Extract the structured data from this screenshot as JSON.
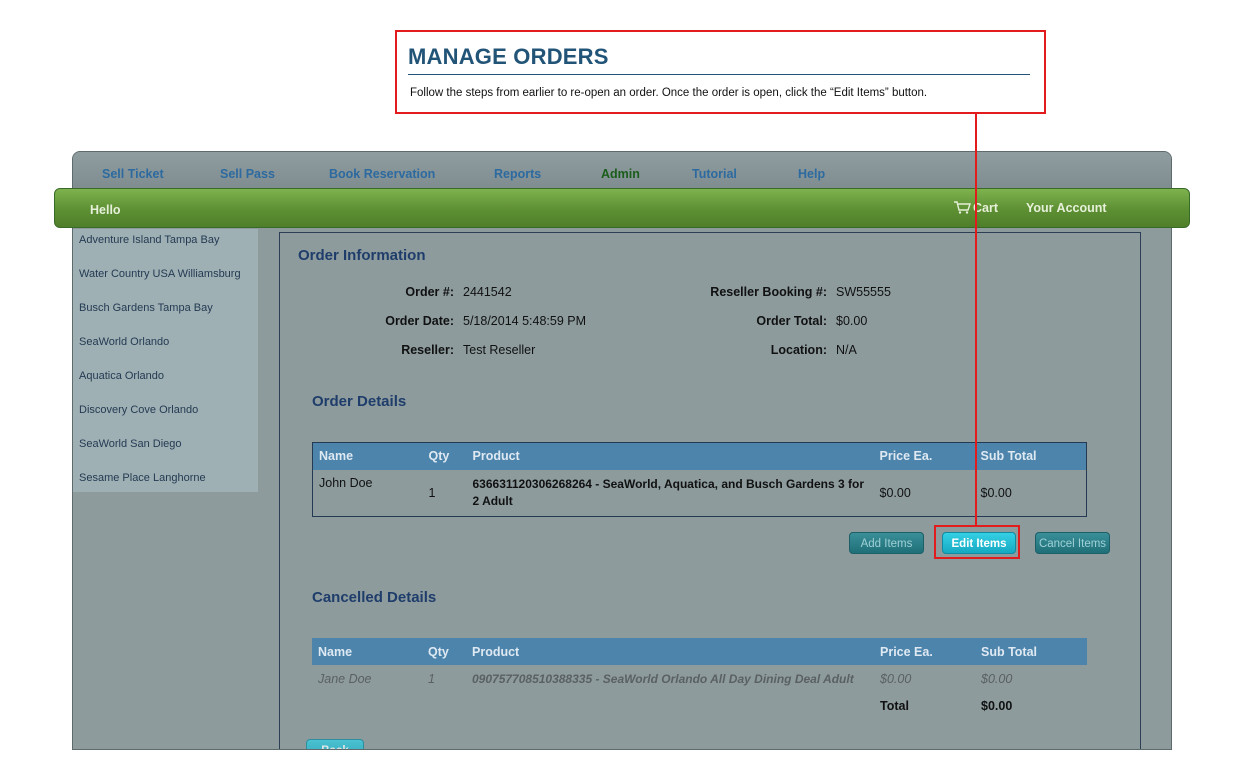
{
  "callout": {
    "title": "MANAGE ORDERS",
    "text": "Follow the steps from earlier to re-open an order. Once the order is open, click the “Edit Items” button."
  },
  "nav": {
    "items": [
      "Sell Ticket",
      "Sell Pass",
      "Book Reservation",
      "Reports",
      "Admin",
      "Tutorial",
      "Help"
    ],
    "active": "Admin"
  },
  "greenbar": {
    "hello": "Hello",
    "cart": "Cart",
    "account": "Your Account"
  },
  "sidebar": {
    "items": [
      "Adventure Island Tampa Bay",
      "Water Country USA Williamsburg",
      "Busch Gardens Tampa Bay",
      "SeaWorld Orlando",
      "Aquatica Orlando",
      "Discovery Cove Orlando",
      "SeaWorld San Diego",
      "Sesame Place Langhorne"
    ]
  },
  "order_info": {
    "heading": "Order Information",
    "order_no_label": "Order #:",
    "order_no": "2441542",
    "order_date_label": "Order Date:",
    "order_date": "5/18/2014 5:48:59 PM",
    "reseller_label": "Reseller:",
    "reseller": "Test Reseller",
    "booking_label": "Reseller Booking #:",
    "booking": "SW55555",
    "total_label": "Order Total:",
    "total": "$0.00",
    "location_label": "Location:",
    "location": "N/A"
  },
  "order_details": {
    "heading": "Order Details",
    "columns": [
      "Name",
      "Qty",
      "Product",
      "Price Ea.",
      "Sub Total"
    ],
    "rows": [
      {
        "name": "John Doe",
        "qty": "1",
        "product": "636631120306268264 - SeaWorld, Aquatica, and Busch Gardens 3 for 2 Adult",
        "price": "$0.00",
        "subtotal": "$0.00"
      }
    ]
  },
  "buttons": {
    "add": "Add Items",
    "edit": "Edit Items",
    "cancel": "Cancel Items",
    "back": "Back"
  },
  "cancelled_details": {
    "heading": "Cancelled Details",
    "columns": [
      "Name",
      "Qty",
      "Product",
      "Price Ea.",
      "Sub Total"
    ],
    "rows": [
      {
        "name": "Jane Doe",
        "qty": "1",
        "product": "090757708510388335 - SeaWorld Orlando All Day Dining Deal Adult",
        "price": "$0.00",
        "subtotal": "$0.00"
      }
    ],
    "total_label": "Total",
    "total": "$0.00"
  },
  "colors": {
    "accent_red": "#e21c1c",
    "green_bar": "#5d8f33",
    "header_blue": "#4c84ac"
  }
}
